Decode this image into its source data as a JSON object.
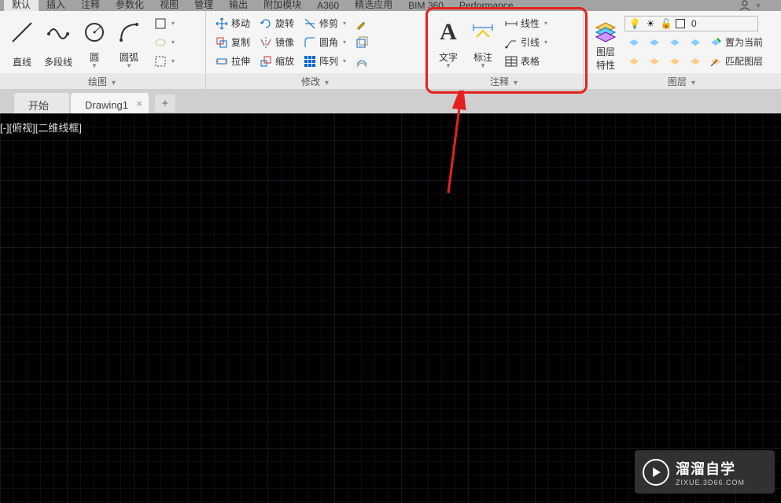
{
  "menu": {
    "items": [
      "默认",
      "插入",
      "注释",
      "参数化",
      "视图",
      "管理",
      "输出",
      "附加模块",
      "A360",
      "精选应用",
      "BIM 360",
      "Performance"
    ],
    "active": "默认"
  },
  "panels": {
    "draw": {
      "title": "绘图",
      "line": "直线",
      "polyline": "多段线",
      "circle": "圆",
      "arc": "圆弧"
    },
    "modify": {
      "title": "修改",
      "move": "移动",
      "copy": "复制",
      "stretch": "拉伸",
      "rotate": "旋转",
      "mirror": "镜像",
      "scale": "缩放",
      "trim": "修剪",
      "fillet": "圆角",
      "array": "阵列"
    },
    "annotation": {
      "title": "注释",
      "text": "文字",
      "dim": "标注",
      "linear": "线性",
      "leader": "引线",
      "table": "表格"
    },
    "layer": {
      "title": "图层",
      "props": "图层\n特性",
      "make_current": "置为当前",
      "match_layer": "匹配图层",
      "layer_value": "0"
    }
  },
  "tabs": {
    "start": "开始",
    "drawing": "Drawing1"
  },
  "viewport": "[-][俯视][二维线框]",
  "watermark": {
    "title": "溜溜自学",
    "sub": "ZIXUE.3D66.COM"
  }
}
